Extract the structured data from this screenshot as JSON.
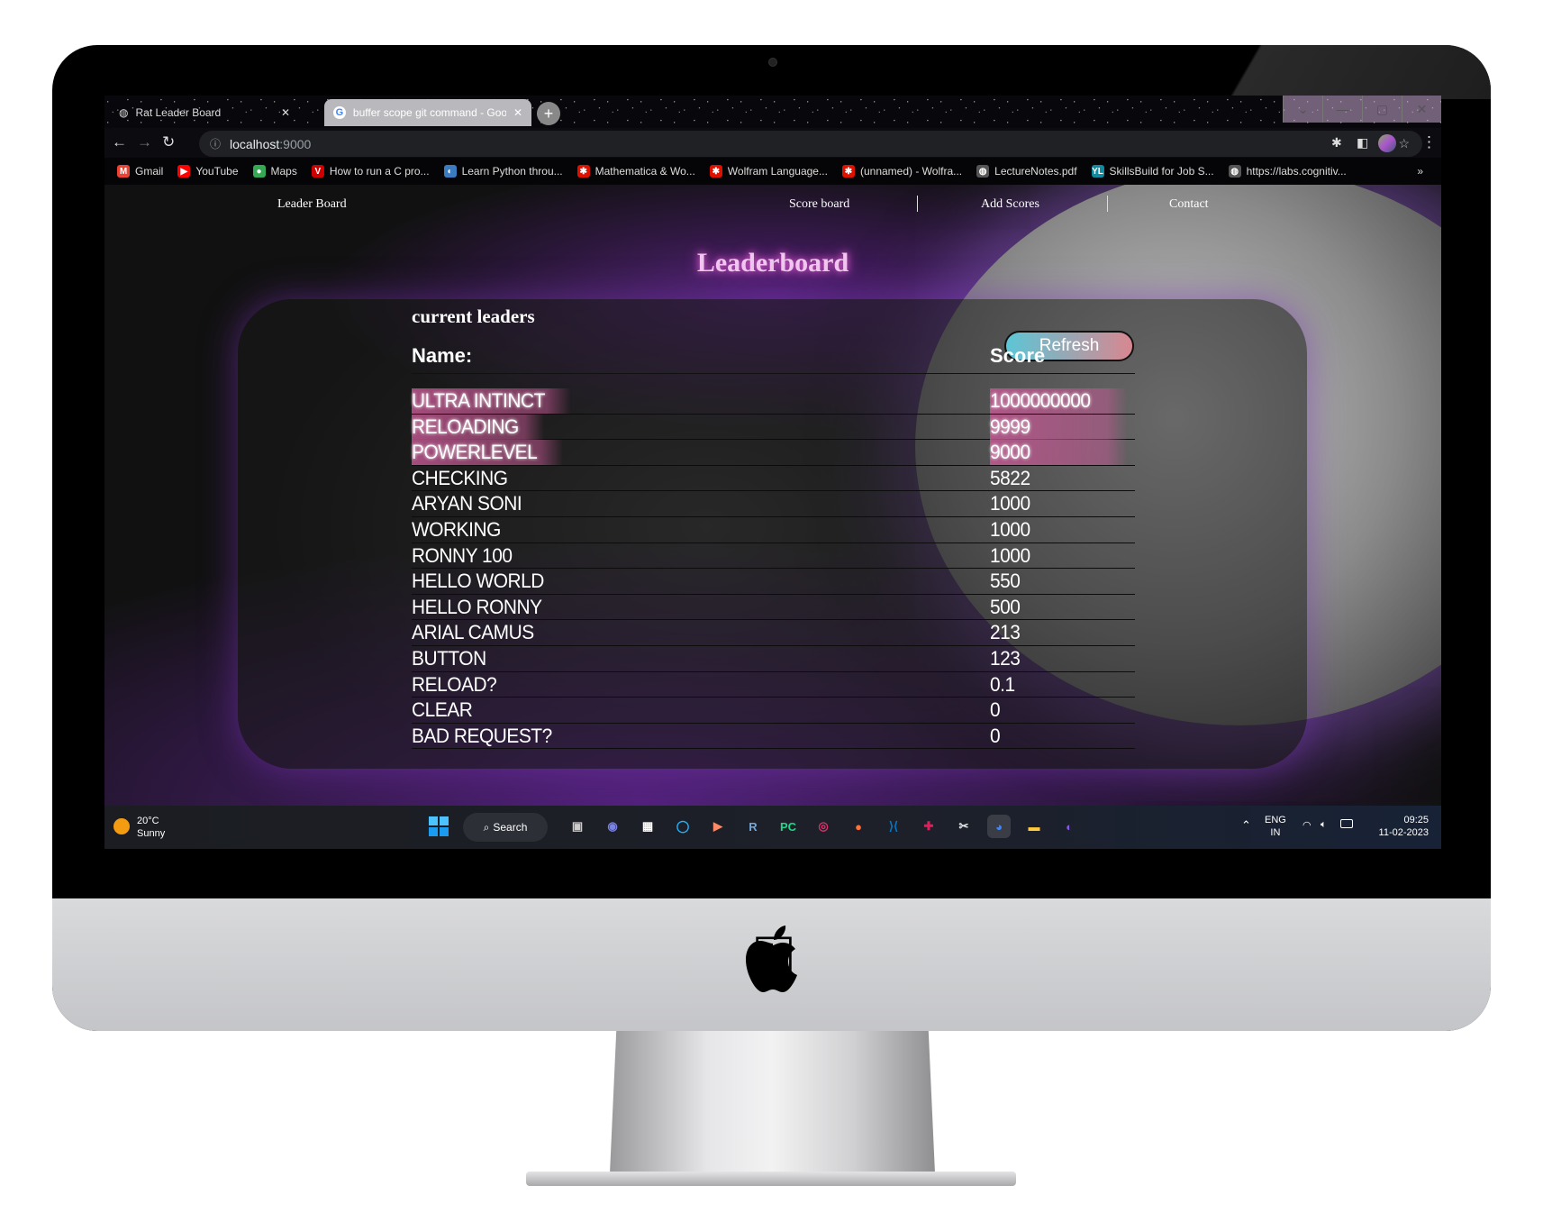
{
  "browser": {
    "tabs": [
      {
        "title": "Rat Leader Board",
        "active": true
      },
      {
        "title": "buffer scope git command - Goo",
        "active": false
      }
    ],
    "new_tab": "+",
    "window_controls": [
      "⌄",
      "—",
      "▢",
      "✕"
    ],
    "url_host": "localhost",
    "url_port": ":9000",
    "bookmarks": [
      {
        "label": "Gmail",
        "icon": "gmail-icon",
        "color": "#ea4335",
        "glyph": "M"
      },
      {
        "label": "YouTube",
        "icon": "youtube-icon",
        "color": "#ff0000",
        "glyph": "▶"
      },
      {
        "label": "Maps",
        "icon": "maps-pin-icon",
        "color": "#34a853",
        "glyph": "●"
      },
      {
        "label": "How to run a C pro...",
        "icon": "v-logo-icon",
        "color": "#d00000",
        "glyph": "V"
      },
      {
        "label": "Learn Python throu...",
        "icon": "python-site-icon",
        "color": "#3b7bbf",
        "glyph": "◐"
      },
      {
        "label": "Mathematica & Wo...",
        "icon": "wolfram-icon",
        "color": "#dd1100",
        "glyph": "✱"
      },
      {
        "label": "Wolfram Language...",
        "icon": "wolfram-icon",
        "color": "#dd1100",
        "glyph": "✱"
      },
      {
        "label": "(unnamed) - Wolfra...",
        "icon": "wolfram-icon",
        "color": "#dd1100",
        "glyph": "✱"
      },
      {
        "label": "LectureNotes.pdf",
        "icon": "globe-icon",
        "color": "#555555",
        "glyph": "◍"
      },
      {
        "label": "SkillsBuild for Job S...",
        "icon": "skillsbuild-icon",
        "color": "#0f8aa0",
        "glyph": "YL"
      },
      {
        "label": "https://labs.cognitiv...",
        "icon": "globe-icon",
        "color": "#555555",
        "glyph": "◍"
      }
    ],
    "bookmarks_more": "»"
  },
  "page": {
    "nav": {
      "brand": "Leader Board",
      "links": [
        "Score board",
        "Add Scores",
        "Contact"
      ]
    },
    "title": "Leaderboard",
    "subtitle": "current leaders",
    "refresh_label": "Refresh",
    "columns": [
      "Name:",
      "Score"
    ],
    "rows": [
      {
        "name": "ULTRA INTINCT",
        "score": "1000000000",
        "highlight": true
      },
      {
        "name": "RELOADING",
        "score": "9999",
        "highlight": true
      },
      {
        "name": "POWERLEVEL",
        "score": "9000",
        "highlight": true
      },
      {
        "name": "CHECKING",
        "score": "5822",
        "highlight": false
      },
      {
        "name": "ARYAN SONI",
        "score": "1000",
        "highlight": false
      },
      {
        "name": "WORKING",
        "score": "1000",
        "highlight": false
      },
      {
        "name": "RONNY 100",
        "score": "1000",
        "highlight": false
      },
      {
        "name": "HELLO WORLD",
        "score": "550",
        "highlight": false
      },
      {
        "name": "HELLO RONNY",
        "score": "500",
        "highlight": false
      },
      {
        "name": "ARIAL CAMUS",
        "score": "213",
        "highlight": false
      },
      {
        "name": "BUTTON",
        "score": "123",
        "highlight": false
      },
      {
        "name": "RELOAD?",
        "score": "0.1",
        "highlight": false
      },
      {
        "name": "CLEAR",
        "score": "0",
        "highlight": false
      },
      {
        "name": "BAD REQUEST?",
        "score": "0",
        "highlight": false
      }
    ]
  },
  "taskbar": {
    "weather": {
      "temp": "20°C",
      "condition": "Sunny"
    },
    "search_label": "Search",
    "apps": [
      {
        "icon": "task-view-icon",
        "color": "#cccccc",
        "glyph": "▣"
      },
      {
        "icon": "teams-chat-icon",
        "color": "#7b83eb",
        "glyph": "◉"
      },
      {
        "icon": "store-icon",
        "color": "#ffffff",
        "glyph": "▦"
      },
      {
        "icon": "cortana-icon",
        "color": "#1fb6ff",
        "glyph": "◯"
      },
      {
        "icon": "media-player-icon",
        "color": "#ff8a65",
        "glyph": "▶"
      },
      {
        "icon": "r-icon",
        "color": "#6fa8dc",
        "glyph": "R"
      },
      {
        "icon": "pycharm-icon",
        "color": "#21d789",
        "glyph": "PC"
      },
      {
        "icon": "instagram-icon",
        "color": "#e1306c",
        "glyph": "◎"
      },
      {
        "icon": "firefox-icon",
        "color": "#ff7139",
        "glyph": "●"
      },
      {
        "icon": "vscode-icon",
        "color": "#007acc",
        "glyph": "⟩⟨"
      },
      {
        "icon": "slack-icon",
        "color": "#e01e5a",
        "glyph": "✚"
      },
      {
        "icon": "snipping-tool-icon",
        "color": "#e8e8e8",
        "glyph": "✂"
      },
      {
        "icon": "chrome-icon",
        "color": "#4285f4",
        "glyph": "◕"
      },
      {
        "icon": "file-explorer-icon",
        "color": "#ffc83d",
        "glyph": "▬"
      },
      {
        "icon": "github-icon",
        "color": "#8957e5",
        "glyph": "◐"
      }
    ],
    "lang": "ENG",
    "region": "IN",
    "time": "09:25",
    "date": "11-02-2023"
  }
}
